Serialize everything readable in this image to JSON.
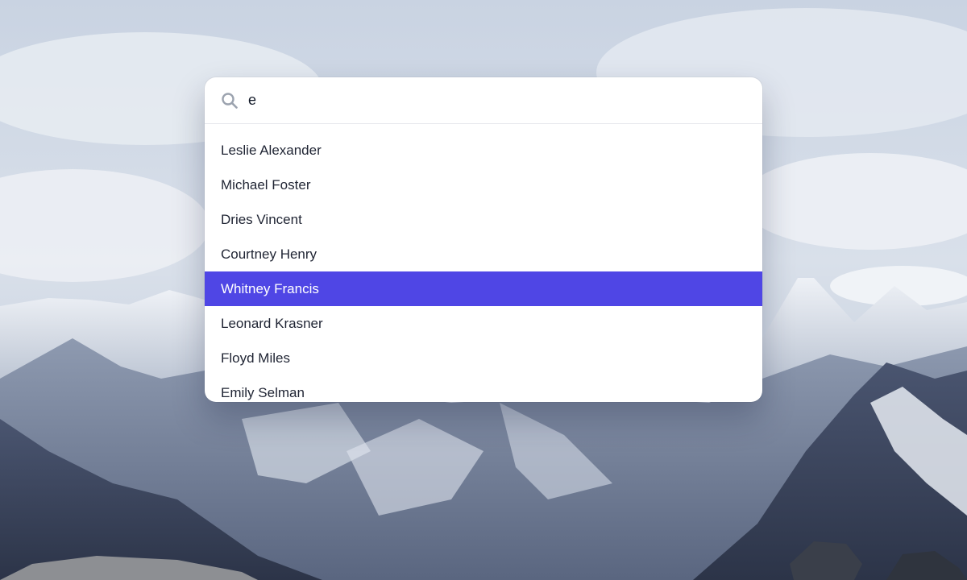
{
  "search": {
    "value": "e",
    "placeholder": "Search..."
  },
  "results": [
    {
      "label": "Leslie Alexander",
      "active": false
    },
    {
      "label": "Michael Foster",
      "active": false
    },
    {
      "label": "Dries Vincent",
      "active": false
    },
    {
      "label": "Courtney Henry",
      "active": false
    },
    {
      "label": "Whitney Francis",
      "active": true
    },
    {
      "label": "Leonard Krasner",
      "active": false
    },
    {
      "label": "Floyd Miles",
      "active": false
    },
    {
      "label": "Emily Selman",
      "active": false
    }
  ],
  "colors": {
    "accent": "#4f46e5",
    "text": "#1f2433",
    "icon": "#9ca3af"
  },
  "icons": {
    "search": "search-icon"
  }
}
